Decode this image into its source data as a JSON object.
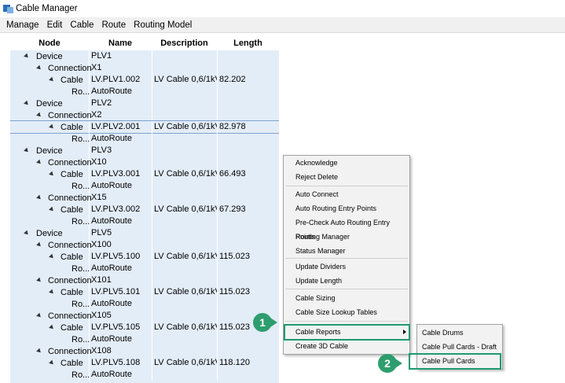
{
  "window": {
    "title": "Cable Manager"
  },
  "menubar": [
    "Manage",
    "Edit",
    "Cable",
    "Route",
    "Routing Model"
  ],
  "grid": {
    "columns": [
      "Node",
      "Name",
      "Description",
      "Length"
    ],
    "rows": [
      {
        "level": 0,
        "node": "Device",
        "name": "PLV1",
        "desc": "",
        "len": ""
      },
      {
        "level": 1,
        "node": "Connection",
        "name": "X1",
        "desc": "",
        "len": ""
      },
      {
        "level": 2,
        "node": "Cable",
        "name": "LV.PLV1.002",
        "desc": "LV Cable 0,6/1kV...",
        "len": "82.202"
      },
      {
        "level": 3,
        "node": "Ro...",
        "name": "AutoRoute",
        "desc": "",
        "len": ""
      },
      {
        "level": 0,
        "node": "Device",
        "name": "PLV2",
        "desc": "",
        "len": ""
      },
      {
        "level": 1,
        "node": "Connection",
        "name": "X2",
        "desc": "",
        "len": ""
      },
      {
        "level": 2,
        "node": "Cable",
        "name": "LV.PLV2.001",
        "desc": "LV Cable 0,6/1kV...",
        "len": "82.978",
        "selected": true
      },
      {
        "level": 3,
        "node": "Ro...",
        "name": "AutoRoute",
        "desc": "",
        "len": ""
      },
      {
        "level": 0,
        "node": "Device",
        "name": "PLV3",
        "desc": "",
        "len": ""
      },
      {
        "level": 1,
        "node": "Connection",
        "name": "X10",
        "desc": "",
        "len": ""
      },
      {
        "level": 2,
        "node": "Cable",
        "name": "LV.PLV3.001",
        "desc": "LV Cable 0,6/1kV...",
        "len": "66.493"
      },
      {
        "level": 3,
        "node": "Ro...",
        "name": "AutoRoute",
        "desc": "",
        "len": ""
      },
      {
        "level": 1,
        "node": "Connection",
        "name": "X15",
        "desc": "",
        "len": ""
      },
      {
        "level": 2,
        "node": "Cable",
        "name": "LV.PLV3.002",
        "desc": "LV Cable 0,6/1kV...",
        "len": "67.293"
      },
      {
        "level": 3,
        "node": "Ro...",
        "name": "AutoRoute",
        "desc": "",
        "len": ""
      },
      {
        "level": 0,
        "node": "Device",
        "name": "PLV5",
        "desc": "",
        "len": ""
      },
      {
        "level": 1,
        "node": "Connection",
        "name": "X100",
        "desc": "",
        "len": ""
      },
      {
        "level": 2,
        "node": "Cable",
        "name": "LV.PLV5.100",
        "desc": "LV Cable 0,6/1kV...",
        "len": "115.023"
      },
      {
        "level": 3,
        "node": "Ro...",
        "name": "AutoRoute",
        "desc": "",
        "len": ""
      },
      {
        "level": 1,
        "node": "Connection",
        "name": "X101",
        "desc": "",
        "len": ""
      },
      {
        "level": 2,
        "node": "Cable",
        "name": "LV.PLV5.101",
        "desc": "LV Cable 0,6/1kV...",
        "len": "115.023"
      },
      {
        "level": 3,
        "node": "Ro...",
        "name": "AutoRoute",
        "desc": "",
        "len": ""
      },
      {
        "level": 1,
        "node": "Connection",
        "name": "X105",
        "desc": "",
        "len": ""
      },
      {
        "level": 2,
        "node": "Cable",
        "name": "LV.PLV5.105",
        "desc": "LV Cable 0,6/1kV...",
        "len": "115.023"
      },
      {
        "level": 3,
        "node": "Ro...",
        "name": "AutoRoute",
        "desc": "",
        "len": ""
      },
      {
        "level": 1,
        "node": "Connection",
        "name": "X108",
        "desc": "",
        "len": ""
      },
      {
        "level": 2,
        "node": "Cable",
        "name": "LV.PLV5.108",
        "desc": "LV Cable 0,6/1kV...",
        "len": "118.120"
      },
      {
        "level": 3,
        "node": "Ro...",
        "name": "AutoRoute",
        "desc": "",
        "len": ""
      }
    ]
  },
  "context_menu": [
    "Acknowledge",
    "Reject Delete",
    "Auto Connect",
    "Auto Routing Entry Points",
    "Pre-Check Auto Routing Entry Points",
    "Routing Manager",
    "Status Manager",
    "Update Dividers",
    "Update Length",
    "Cable Sizing",
    "Cable Size Lookup Tables",
    "Cable Reports",
    "Create 3D Cable"
  ],
  "submenu": [
    "Cable Drums",
    "Cable Pull Cards - Draft",
    "Cable Pull Cards"
  ],
  "callouts": [
    "1",
    "2"
  ],
  "colors": {
    "grid_bg": "#e3edf8",
    "callout": "#2e9e6e",
    "highlight": "#1f9a6f"
  }
}
